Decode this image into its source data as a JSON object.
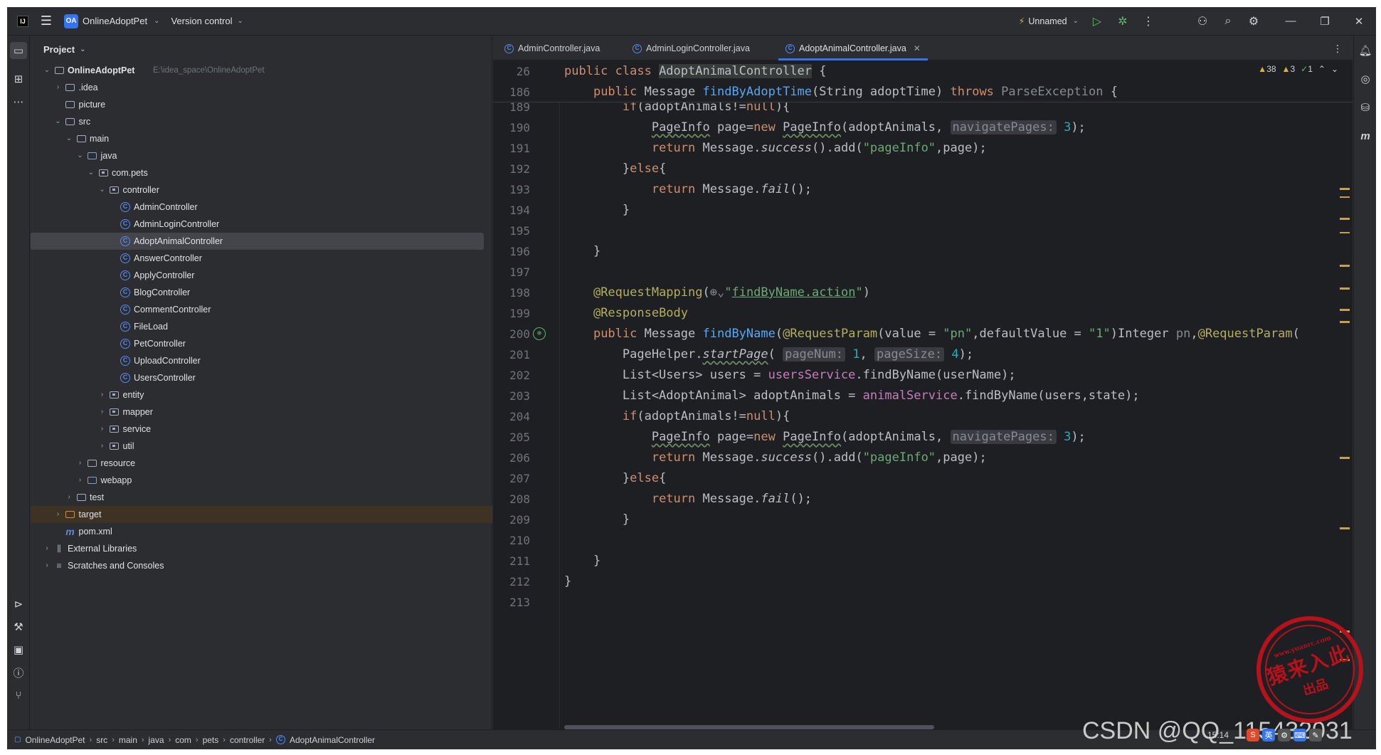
{
  "title_bar": {
    "project_badge": "OA",
    "project_name": "OnlineAdoptPet",
    "vcs_label": "Version control",
    "run_config": "Unnamed"
  },
  "project_panel": {
    "title": "Project",
    "root_path": "E:\\idea_space\\OnlineAdoptPet",
    "tree": [
      {
        "label": "OnlineAdoptPet",
        "level": 0,
        "type": "module",
        "expanded": true
      },
      {
        "label": ".idea",
        "level": 1,
        "type": "folder",
        "expanded": false
      },
      {
        "label": "picture",
        "level": 1,
        "type": "folder",
        "expanded": null
      },
      {
        "label": "src",
        "level": 1,
        "type": "folder",
        "expanded": true
      },
      {
        "label": "main",
        "level": 2,
        "type": "folder",
        "expanded": true
      },
      {
        "label": "java",
        "level": 3,
        "type": "source",
        "expanded": true
      },
      {
        "label": "com.pets",
        "level": 4,
        "type": "package",
        "expanded": true
      },
      {
        "label": "controller",
        "level": 5,
        "type": "package",
        "expanded": true
      },
      {
        "label": "AdminController",
        "level": 6,
        "type": "class"
      },
      {
        "label": "AdminLoginController",
        "level": 6,
        "type": "class"
      },
      {
        "label": "AdoptAnimalController",
        "level": 6,
        "type": "class",
        "selected": true
      },
      {
        "label": "AnswerController",
        "level": 6,
        "type": "class"
      },
      {
        "label": "ApplyController",
        "level": 6,
        "type": "class"
      },
      {
        "label": "BlogController",
        "level": 6,
        "type": "class"
      },
      {
        "label": "CommentController",
        "level": 6,
        "type": "class"
      },
      {
        "label": "FileLoad",
        "level": 6,
        "type": "class"
      },
      {
        "label": "PetController",
        "level": 6,
        "type": "class"
      },
      {
        "label": "UploadController",
        "level": 6,
        "type": "class"
      },
      {
        "label": "UsersController",
        "level": 6,
        "type": "class"
      },
      {
        "label": "entity",
        "level": 5,
        "type": "package",
        "expanded": false
      },
      {
        "label": "mapper",
        "level": 5,
        "type": "package",
        "expanded": false
      },
      {
        "label": "service",
        "level": 5,
        "type": "package",
        "expanded": false
      },
      {
        "label": "util",
        "level": 5,
        "type": "package",
        "expanded": false
      },
      {
        "label": "resource",
        "level": 3,
        "type": "folder",
        "expanded": false
      },
      {
        "label": "webapp",
        "level": 3,
        "type": "source",
        "expanded": false
      },
      {
        "label": "test",
        "level": 2,
        "type": "folder",
        "expanded": false
      },
      {
        "label": "target",
        "level": 1,
        "type": "excluded",
        "expanded": false
      },
      {
        "label": "pom.xml",
        "level": 1,
        "type": "maven"
      },
      {
        "label": "External Libraries",
        "level": 0,
        "type": "library",
        "expanded": false
      },
      {
        "label": "Scratches and Consoles",
        "level": 0,
        "type": "scratch",
        "expanded": false
      }
    ]
  },
  "editor": {
    "tabs": [
      {
        "label": "AdminController.java",
        "active": false
      },
      {
        "label": "AdminLoginController.java",
        "active": false
      },
      {
        "label": "AdoptAnimalController.java",
        "active": true
      }
    ],
    "inspections": {
      "warnings": "38",
      "weak_warnings": "3",
      "ok": "1"
    },
    "sticky_lines": [
      {
        "ln": "26"
      },
      {
        "ln": "186"
      }
    ],
    "line_numbers": [
      "189",
      "190",
      "191",
      "192",
      "193",
      "194",
      "195",
      "196",
      "197",
      "198",
      "199",
      "200",
      "201",
      "202",
      "203",
      "204",
      "205",
      "206",
      "207",
      "208",
      "209",
      "210",
      "211",
      "212",
      "213"
    ]
  },
  "status_bar": {
    "breadcrumbs": [
      "OnlineAdoptPet",
      "src",
      "main",
      "java",
      "com",
      "pets",
      "controller",
      "AdoptAnimalController"
    ]
  },
  "watermarks": {
    "csdn": "CSDN @QQ_115432031",
    "seal_url": "www.yuanrc.com",
    "seal_name": "猿来入此",
    "seal_sub": "出品",
    "clock": "15:14"
  }
}
